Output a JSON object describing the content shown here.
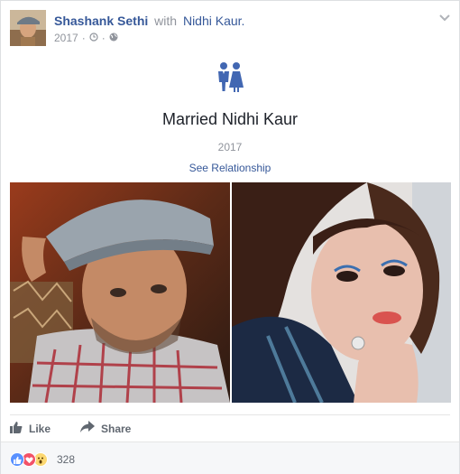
{
  "post": {
    "author": "Shashank Sethi",
    "with_word": "with",
    "tagged": "Nidhi Kaur",
    "tag_suffix": ".",
    "year": "2017",
    "meta_separator": "·",
    "privacy_icon": "globe-icon",
    "clock_icon": "clock-icon",
    "options_icon": "chevron-down-icon"
  },
  "life_event": {
    "icon": "couple-icon",
    "title": "Married Nidhi Kaur",
    "year": "2017",
    "link": "See Relationship"
  },
  "photos": [
    {
      "subject": "man in grey cap and checked shirt"
    },
    {
      "subject": "woman with brown hair and red lipstick"
    }
  ],
  "actions": {
    "like": "Like",
    "share": "Share"
  },
  "reactions": {
    "types": [
      "like",
      "love",
      "wow"
    ],
    "count": "328"
  },
  "colors": {
    "link": "#365899",
    "secondary_text": "#90949c",
    "like_blue": "#5890ff",
    "love_red": "#f25268",
    "wow_yellow": "#fcd872"
  }
}
